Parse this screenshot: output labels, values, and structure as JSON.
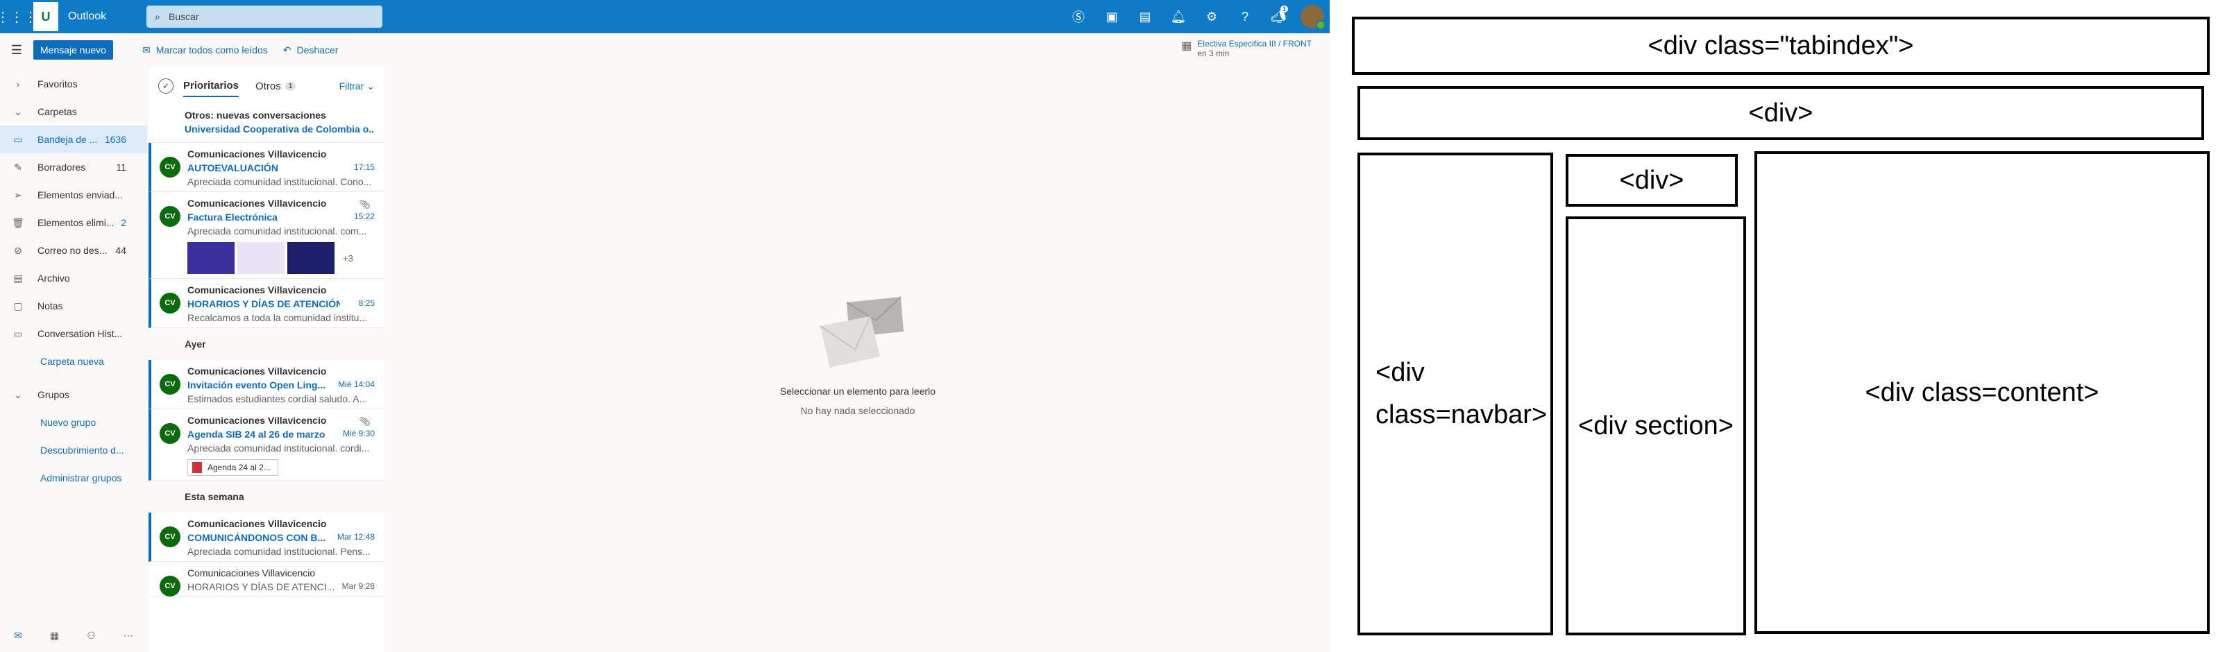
{
  "app": {
    "name": "Outlook",
    "search_placeholder": "Buscar",
    "notif_count": "1"
  },
  "toolbar": {
    "new_message": "Mensaje nuevo",
    "mark_all_read": "Marcar todos como leídos",
    "undo": "Deshacer",
    "event_title": "Electiva Especifica III / FRONT",
    "event_when": "en 3 min"
  },
  "nav": {
    "favorites": "Favoritos",
    "folders": "Carpetas",
    "items": [
      {
        "label": "Bandeja de ...",
        "count": "1636",
        "icon": "inbox-icon"
      },
      {
        "label": "Borradores",
        "count": "11",
        "icon": "pencil-icon"
      },
      {
        "label": "Elementos enviad...",
        "count": "",
        "icon": "send-icon"
      },
      {
        "label": "Elementos elimi...",
        "count": "2",
        "icon": "trash-icon"
      },
      {
        "label": "Correo no des...",
        "count": "44",
        "icon": "blocked-icon"
      },
      {
        "label": "Archivo",
        "count": "",
        "icon": "archive-icon"
      },
      {
        "label": "Notas",
        "count": "",
        "icon": "note-icon"
      },
      {
        "label": "Conversation Hist...",
        "count": "",
        "icon": "folder-icon"
      }
    ],
    "new_folder": "Carpeta nueva",
    "groups": "Grupos",
    "group_links": [
      "Nuevo grupo",
      "Descubrimiento d...",
      "Administrar grupos"
    ]
  },
  "list": {
    "tab_focused": "Prioritarios",
    "tab_other": "Otros",
    "other_count": "1",
    "filter": "Filtrar",
    "other_header": "Otros: nuevas conversaciones",
    "other_sender": "Universidad Cooperativa de Colombia o...",
    "groups": {
      "yesterday": "Ayer",
      "this_week": "Esta semana"
    },
    "messages": [
      {
        "initials": "CV",
        "from": "Comunicaciones Villavicencio",
        "subject": "AUTOEVALUACIÓN",
        "time": "17:15",
        "preview": "Apreciada comunidad institucional. Cono..."
      },
      {
        "initials": "CV",
        "from": "Comunicaciones Villavicencio",
        "subject": "Factura Electrónica",
        "time": "15:22",
        "preview": "Apreciada comunidad institucional. com...",
        "more": "+3"
      },
      {
        "initials": "CV",
        "from": "Comunicaciones Villavicencio",
        "subject": "HORARIOS Y DÍAS DE ATENCIÓN ...",
        "time": "8:25",
        "preview": "Recalcamos a toda la comunidad institu..."
      },
      {
        "initials": "CV",
        "from": "Comunicaciones Villavicencio",
        "subject": "Invitación evento Open Ling...",
        "time": "Mié 14:04",
        "preview": "Estimados estudiantes cordial saludo. A..."
      },
      {
        "initials": "CV",
        "from": "Comunicaciones Villavicencio",
        "subject": "Agenda SIB 24 al 26 de marzo",
        "time": "Mié 9:30",
        "preview": "Apreciada comunidad institucional. cordi...",
        "attachment": "Agenda 24 al 2..."
      },
      {
        "initials": "CV",
        "from": "Comunicaciones Villavicencio",
        "subject": "COMUNICÁNDONOS CON B...",
        "time": "Mar 12:48",
        "preview": "Apreciada comunidad institucional. Pens..."
      },
      {
        "initials": "CV",
        "from": "Comunicaciones Villavicencio",
        "subject": "HORARIOS Y DÍAS DE ATENCI...",
        "time": "Mar 9:28",
        "preview": ""
      }
    ]
  },
  "reading": {
    "title": "Seleccionar un elemento para leerlo",
    "subtitle": "No hay nada seleccionado"
  },
  "diagram": {
    "tabindex": "<div class=\"tabindex\">",
    "div": "<div>",
    "navbar_line1": "<div",
    "navbar_line2": "class=navbar>",
    "div_small": "<div>",
    "section": "<div section>",
    "content": "<div class=content>"
  }
}
